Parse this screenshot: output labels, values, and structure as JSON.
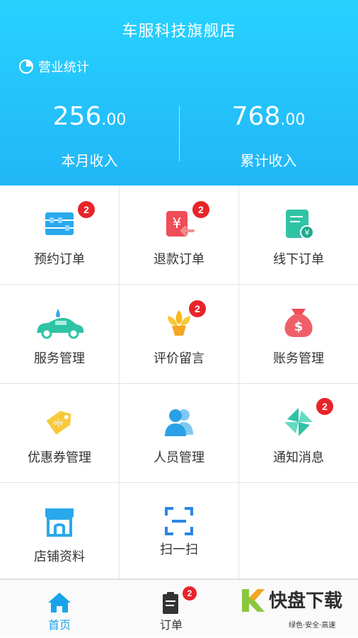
{
  "header": {
    "store_name": "车服科技旗舰店",
    "stats_title": "营业统计",
    "month_income": {
      "whole": "256",
      "decimal": ".00",
      "label": "本月收入"
    },
    "total_income": {
      "whole": "768",
      "decimal": ".00",
      "label": "累计收入"
    }
  },
  "menu": {
    "items": [
      {
        "label": "预约订单",
        "badge": "2",
        "icon": "abacus-icon"
      },
      {
        "label": "退款订单",
        "badge": "2",
        "icon": "refund-icon"
      },
      {
        "label": "线下订单",
        "badge": "",
        "icon": "offline-order-icon"
      },
      {
        "label": "服务管理",
        "badge": "",
        "icon": "car-wash-icon"
      },
      {
        "label": "评价留言",
        "badge": "2",
        "icon": "flower-icon"
      },
      {
        "label": "账务管理",
        "badge": "",
        "icon": "money-bag-icon"
      },
      {
        "label": "优惠券管理",
        "badge": "",
        "icon": "coupon-tag-icon"
      },
      {
        "label": "人员管理",
        "badge": "",
        "icon": "people-icon"
      },
      {
        "label": "通知消息",
        "badge": "2",
        "icon": "pinwheel-icon"
      },
      {
        "label": "店铺资料",
        "badge": "",
        "icon": "shop-icon"
      },
      {
        "label": "扫一扫",
        "badge": "",
        "icon": "scan-icon"
      }
    ]
  },
  "tabbar": {
    "home_label": "首页",
    "orders_label": "订单",
    "orders_badge": "2"
  },
  "watermark": {
    "main": "快盘下载",
    "sub": "绿色·安全·高速"
  },
  "colors": {
    "header_top": "#27d2ff",
    "header_bottom": "#22b6f7",
    "badge": "#e8242a",
    "tab_active": "#1aa3ea"
  }
}
